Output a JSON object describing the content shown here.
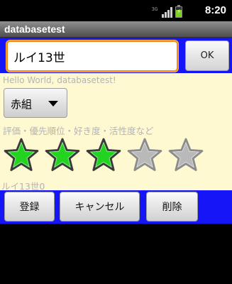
{
  "status_bar": {
    "network_label": "3G",
    "time": "8:20",
    "battery_level": 0.7,
    "battery_charging": true,
    "signal_icon": "signal-icon",
    "battery_icon": "battery-charging-icon"
  },
  "app": {
    "title": "databasetest"
  },
  "form": {
    "name_value": "ルイ13世",
    "ok_label": "OK",
    "hello_text": "Hello World, databasetest!",
    "group_selected": "赤組",
    "rating_hint": "評価・優先順位・好き度・活性度など",
    "rating": {
      "value": 3,
      "max": 5,
      "filled_color": "#22d41f",
      "empty_color": "#b9b9b9"
    },
    "status_text": "ルイ13世0"
  },
  "buttons": {
    "register": "登録",
    "cancel": "キャンセル",
    "delete": "削除"
  },
  "colors": {
    "accent_blue": "#1515f7",
    "background_cream": "#fff9d2",
    "focus_orange": "#f28a16"
  }
}
